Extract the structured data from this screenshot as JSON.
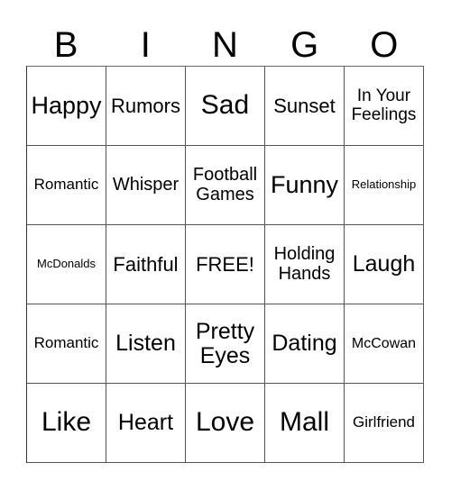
{
  "header": {
    "letters": [
      "B",
      "I",
      "N",
      "G",
      "O"
    ]
  },
  "card": {
    "rows": [
      [
        "Happy",
        "Rumors",
        "Sad",
        "Sunset",
        "In Your Feelings"
      ],
      [
        "Romantic",
        "Whisper",
        "Football Games",
        "Funny",
        "Relationship"
      ],
      [
        "McDonalds",
        "Faithful",
        "FREE!",
        "Holding Hands",
        "Laugh"
      ],
      [
        "Romantic",
        "Listen",
        "Pretty Eyes",
        "Dating",
        "McCowan"
      ],
      [
        "Like",
        "Heart",
        "Love",
        "Mall",
        "Girlfriend"
      ]
    ]
  }
}
